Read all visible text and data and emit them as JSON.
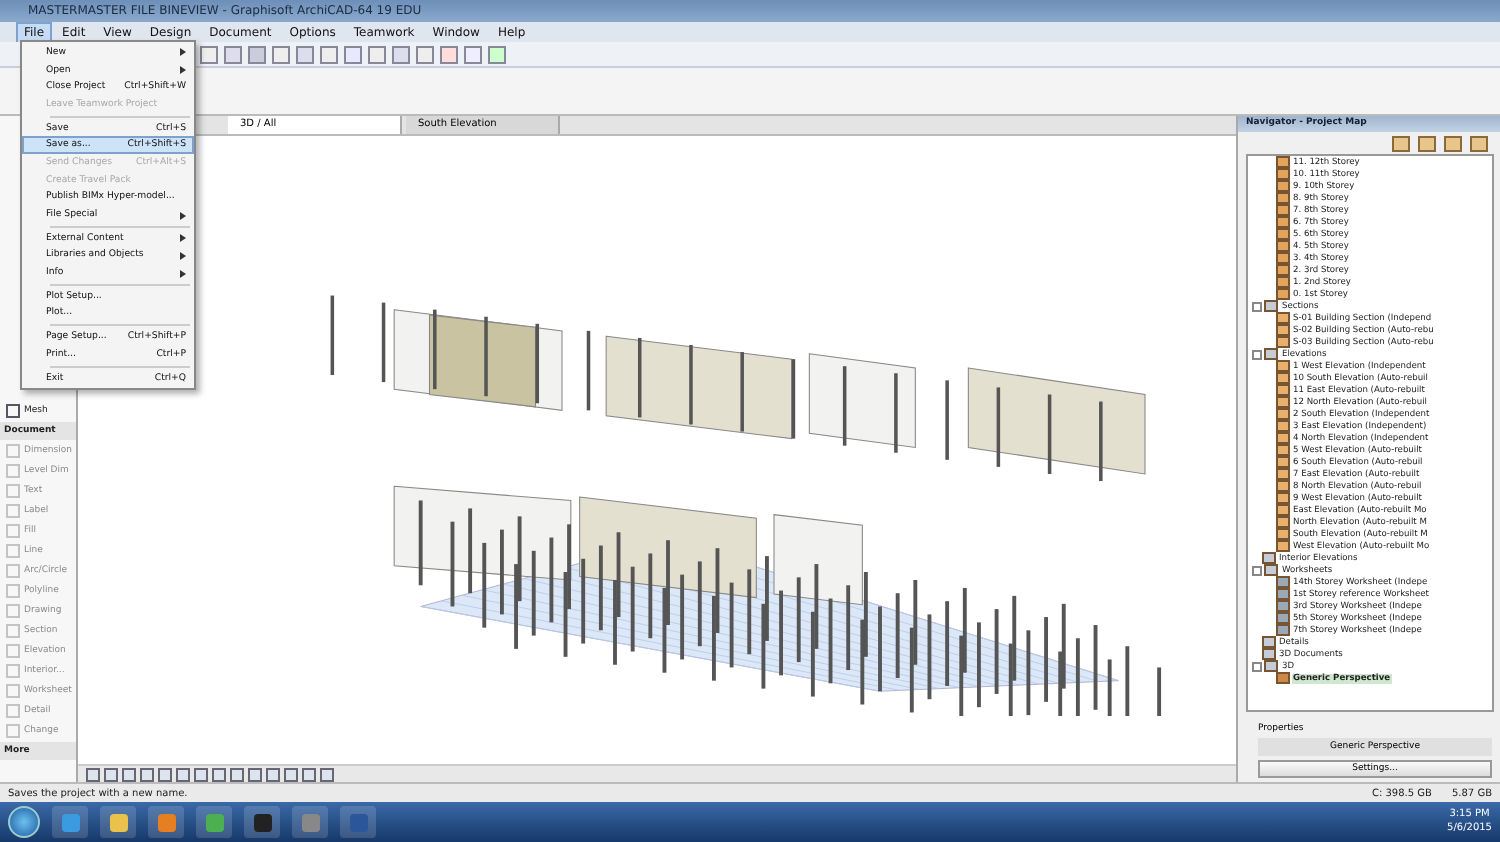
{
  "window": {
    "title": "MASTERMASTER FILE BINEVIEW - Graphisoft ArchiCAD-64 19 EDU"
  },
  "menu_bar": [
    {
      "label": "File",
      "selected": true
    },
    {
      "label": "Edit",
      "selected": false
    },
    {
      "label": "View",
      "selected": false
    },
    {
      "label": "Design",
      "selected": false
    },
    {
      "label": "Document",
      "selected": false
    },
    {
      "label": "Options",
      "selected": false
    },
    {
      "label": "Teamwork",
      "selected": false
    },
    {
      "label": "Window",
      "selected": false
    },
    {
      "label": "Help",
      "selected": false
    }
  ],
  "file_menu": [
    {
      "kind": "item",
      "label": "New",
      "submenu": true,
      "disabled": false,
      "selected": false
    },
    {
      "kind": "item",
      "label": "Open",
      "submenu": true,
      "disabled": false,
      "selected": false
    },
    {
      "kind": "item",
      "label": "Close Project",
      "shortcut": "Ctrl+Shift+W",
      "submenu": false,
      "disabled": false,
      "selected": false
    },
    {
      "kind": "item",
      "label": "Leave Teamwork Project",
      "submenu": false,
      "disabled": true,
      "selected": false
    },
    {
      "kind": "separator"
    },
    {
      "kind": "item",
      "label": "Save",
      "shortcut": "Ctrl+S",
      "submenu": false,
      "disabled": false,
      "selected": false
    },
    {
      "kind": "item",
      "label": "Save as...",
      "shortcut": "Ctrl+Shift+S",
      "submenu": false,
      "disabled": false,
      "selected": true
    },
    {
      "kind": "item",
      "label": "Send Changes",
      "shortcut": "Ctrl+Alt+S",
      "submenu": false,
      "disabled": true,
      "selected": false
    },
    {
      "kind": "item",
      "label": "Create Travel Pack",
      "submenu": false,
      "disabled": true,
      "selected": false
    },
    {
      "kind": "item",
      "label": "Publish BIMx Hyper-model...",
      "submenu": false,
      "disabled": false,
      "selected": false
    },
    {
      "kind": "item",
      "label": "File Special",
      "submenu": true,
      "disabled": false,
      "selected": false
    },
    {
      "kind": "separator"
    },
    {
      "kind": "item",
      "label": "External Content",
      "submenu": true,
      "disabled": false,
      "selected": false
    },
    {
      "kind": "item",
      "label": "Libraries and Objects",
      "submenu": true,
      "disabled": false,
      "selected": false
    },
    {
      "kind": "item",
      "label": "Info",
      "submenu": true,
      "disabled": false,
      "selected": false
    },
    {
      "kind": "separator"
    },
    {
      "kind": "item",
      "label": "Plot Setup...",
      "submenu": false,
      "disabled": false,
      "selected": false
    },
    {
      "kind": "item",
      "label": "Plot...",
      "submenu": false,
      "disabled": false,
      "selected": false
    },
    {
      "kind": "separator"
    },
    {
      "kind": "item",
      "label": "Page Setup...",
      "shortcut": "Ctrl+Shift+P",
      "submenu": false,
      "disabled": false,
      "selected": false
    },
    {
      "kind": "item",
      "label": "Print...",
      "shortcut": "Ctrl+P",
      "submenu": false,
      "disabled": false,
      "selected": false
    },
    {
      "kind": "separator"
    },
    {
      "kind": "item",
      "label": "Exit",
      "shortcut": "Ctrl+Q",
      "submenu": false,
      "disabled": false,
      "selected": false
    }
  ],
  "toolbox": [
    {
      "kind": "tool",
      "label": "Mesh",
      "disabled": false
    },
    {
      "kind": "header",
      "label": "Document",
      "disabled": false
    },
    {
      "kind": "tool",
      "label": "Dimension",
      "disabled": true
    },
    {
      "kind": "tool",
      "label": "Level Dim",
      "disabled": true
    },
    {
      "kind": "tool",
      "label": "Text",
      "disabled": true
    },
    {
      "kind": "tool",
      "label": "Label",
      "disabled": true
    },
    {
      "kind": "tool",
      "label": "Fill",
      "disabled": true
    },
    {
      "kind": "tool",
      "label": "Line",
      "disabled": true
    },
    {
      "kind": "tool",
      "label": "Arc/Circle",
      "disabled": true
    },
    {
      "kind": "tool",
      "label": "Polyline",
      "disabled": true
    },
    {
      "kind": "tool",
      "label": "Drawing",
      "disabled": true
    },
    {
      "kind": "tool",
      "label": "Section",
      "disabled": true
    },
    {
      "kind": "tool",
      "label": "Elevation",
      "disabled": true
    },
    {
      "kind": "tool",
      "label": "Interior...",
      "disabled": true
    },
    {
      "kind": "tool",
      "label": "Worksheet",
      "disabled": true
    },
    {
      "kind": "tool",
      "label": "Detail",
      "disabled": true
    },
    {
      "kind": "tool",
      "label": "Change",
      "disabled": true
    },
    {
      "kind": "header",
      "label": "More",
      "disabled": false
    }
  ],
  "view_tabs": [
    {
      "label": "3D / All",
      "selected": true
    },
    {
      "label": "South Elevation",
      "selected": false
    }
  ],
  "navigator": {
    "title": "Navigator - Project Map",
    "tree_top": [
      {
        "kind": "storey",
        "label": "11. 12th Storey"
      },
      {
        "kind": "storey",
        "label": "10. 11th Storey"
      },
      {
        "kind": "storey",
        "label": "9. 10th Storey"
      },
      {
        "kind": "storey",
        "label": "8. 9th Storey"
      },
      {
        "kind": "storey",
        "label": "7. 8th Storey"
      },
      {
        "kind": "storey",
        "label": "6. 7th Storey"
      },
      {
        "kind": "storey",
        "label": "5. 6th Storey"
      },
      {
        "kind": "storey",
        "label": "4. 5th Storey"
      },
      {
        "kind": "storey",
        "label": "3. 4th Storey"
      },
      {
        "kind": "storey",
        "label": "2. 3rd Storey"
      },
      {
        "kind": "storey",
        "label": "1. 2nd Storey"
      },
      {
        "kind": "storey",
        "label": "0. 1st Storey"
      }
    ],
    "tree": [
      {
        "kind": "folder",
        "label": "Sections",
        "selected": false,
        "children": [
          {
            "kind": "view",
            "label": "S-01 Building Section (Independ",
            "selected": false
          },
          {
            "kind": "view",
            "label": "S-02 Building Section (Auto-rebu",
            "selected": false
          },
          {
            "kind": "view",
            "label": "S-03 Building Section (Auto-rebu",
            "selected": false
          }
        ]
      },
      {
        "kind": "folder",
        "label": "Elevations",
        "selected": false,
        "children": [
          {
            "kind": "view",
            "label": "1 West Elevation (Independent",
            "selected": false
          },
          {
            "kind": "view",
            "label": "10 South Elevation (Auto-rebuil",
            "selected": false
          },
          {
            "kind": "view",
            "label": "11 East Elevation (Auto-rebuilt",
            "selected": false
          },
          {
            "kind": "view",
            "label": "12 North Elevation (Auto-rebuil",
            "selected": false
          },
          {
            "kind": "view",
            "label": "2 South Elevation (Independent",
            "selected": false
          },
          {
            "kind": "view",
            "label": "3 East Elevation (Independent)",
            "selected": false
          },
          {
            "kind": "view",
            "label": "4 North Elevation (Independent",
            "selected": false
          },
          {
            "kind": "view",
            "label": "5 West Elevation (Auto-rebuilt",
            "selected": false
          },
          {
            "kind": "view",
            "label": "6 South Elevation (Auto-rebuil",
            "selected": false
          },
          {
            "kind": "view",
            "label": "7 East Elevation (Auto-rebuilt",
            "selected": false
          },
          {
            "kind": "view",
            "label": "8 North Elevation (Auto-rebuil",
            "selected": false
          },
          {
            "kind": "view",
            "label": "9 West Elevation (Auto-rebuilt",
            "selected": false
          },
          {
            "kind": "view",
            "label": "East Elevation (Auto-rebuilt Mo",
            "selected": false
          },
          {
            "kind": "view",
            "label": "North Elevation (Auto-rebuilt M",
            "selected": false
          },
          {
            "kind": "view",
            "label": "South Elevation (Auto-rebuilt M",
            "selected": false
          },
          {
            "kind": "view",
            "label": "West Elevation (Auto-rebuilt Mo",
            "selected": false
          }
        ]
      },
      {
        "kind": "folder",
        "label": "Interior Elevations",
        "selected": false
      },
      {
        "kind": "folder",
        "label": "Worksheets",
        "selected": false,
        "children": [
          {
            "kind": "sheet",
            "label": "14th Storey Worksheet (Indepe",
            "selected": false
          },
          {
            "kind": "sheet",
            "label": "1st Storey reference Worksheet",
            "selected": false
          },
          {
            "kind": "sheet",
            "label": "3rd Storey Worksheet (Indepe",
            "selected": false
          },
          {
            "kind": "sheet",
            "label": "5th Storey Worksheet (Indepe",
            "selected": false
          },
          {
            "kind": "sheet",
            "label": "7th Storey Worksheet (Indepe",
            "selected": false
          }
        ]
      },
      {
        "kind": "folder",
        "label": "Details",
        "selected": false
      },
      {
        "kind": "folder",
        "label": "3D Documents",
        "selected": false
      },
      {
        "kind": "folder",
        "label": "3D",
        "selected": false,
        "children": [
          {
            "kind": "camera",
            "label": "Generic Perspective",
            "selected": true
          }
        ]
      }
    ],
    "properties_label": "Properties",
    "properties_value": "Generic Perspective",
    "settings_button": "Settings..."
  },
  "status_bar": {
    "message": "Saves the project with a new name.",
    "disk_free": "C: 398.5 GB",
    "memory": "5.87 GB"
  },
  "taskbar": {
    "time": "3:15 PM",
    "date": "5/6/2015"
  }
}
